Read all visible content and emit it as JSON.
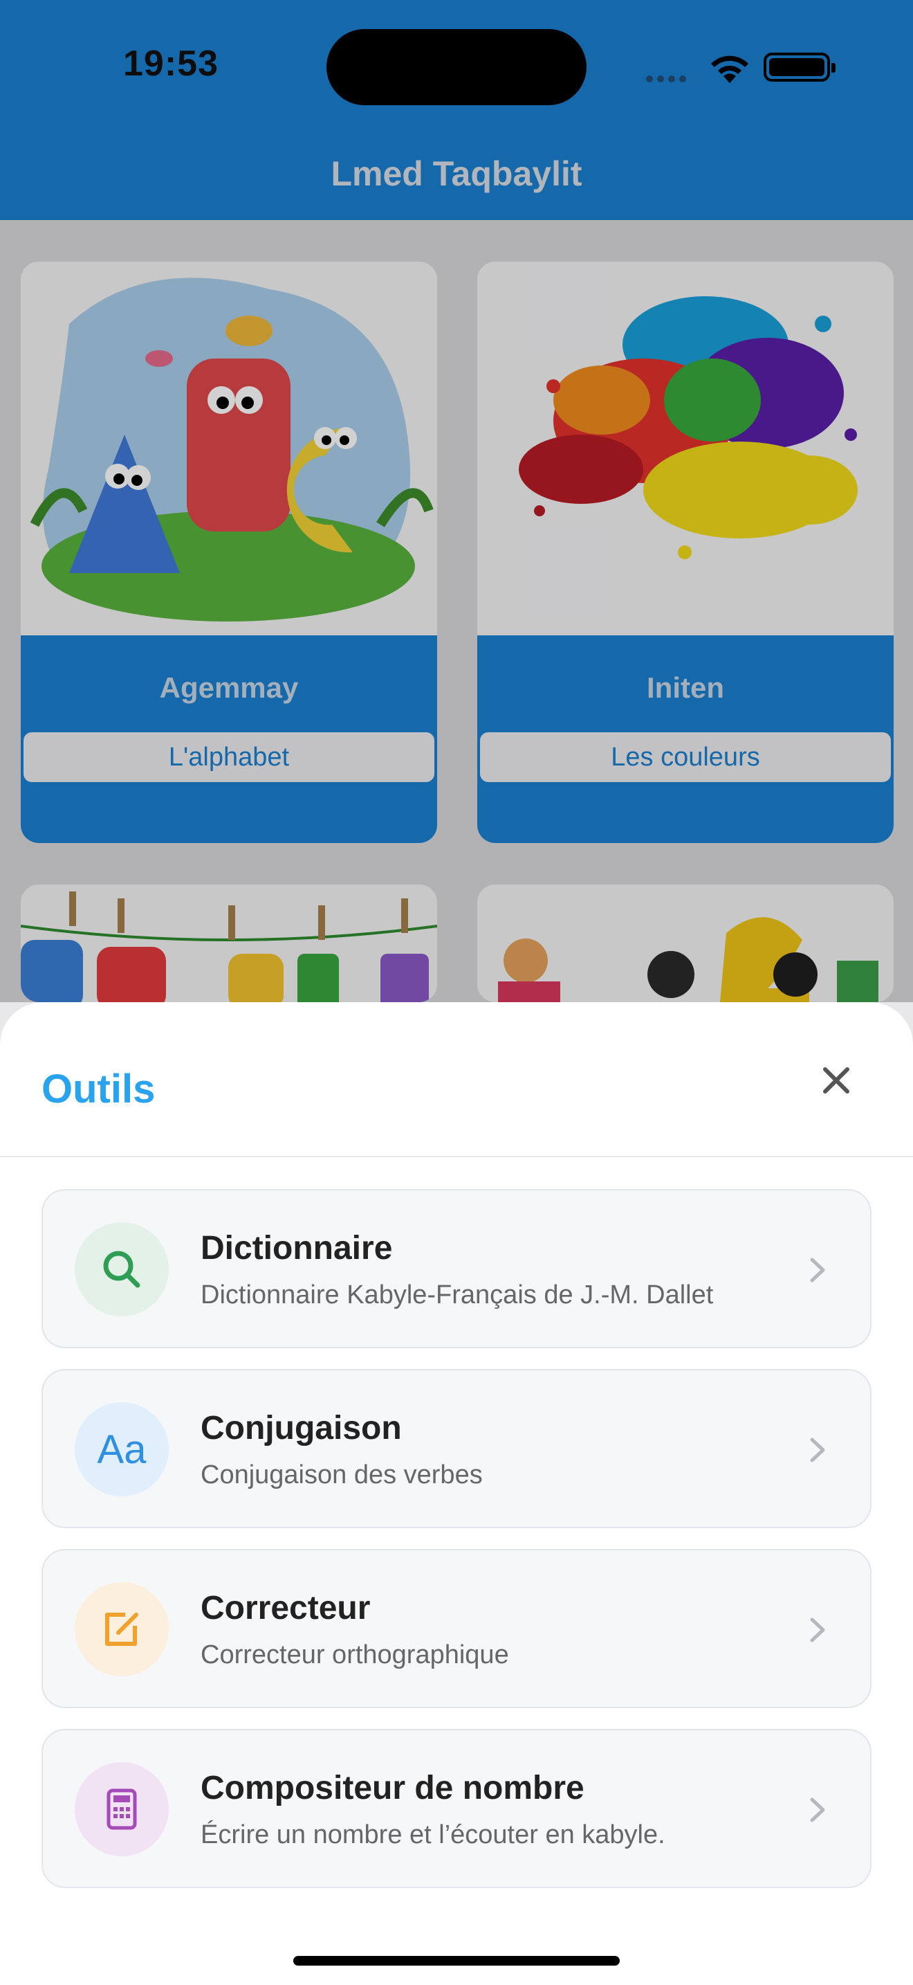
{
  "status_bar": {
    "time": "19:53"
  },
  "header": {
    "title": "Lmed Taqbaylit"
  },
  "cards": [
    {
      "kabyle": "Agemmay",
      "french": "L'alphabet"
    },
    {
      "kabyle": "Initen",
      "french": "Les couleurs"
    }
  ],
  "sheet": {
    "title": "Outils",
    "items": [
      {
        "name": "Dictionnaire",
        "desc": "Dictionnaire Kabyle-Français de J.-M. Dallet",
        "icon": "search-icon",
        "color": "#2e9e54",
        "bg": "#e3f1e8"
      },
      {
        "name": "Conjugaison",
        "desc": "Conjugaison des verbes",
        "icon": "text-aa-icon",
        "icon_text": "Aa",
        "color": "#2f8fe0",
        "bg": "#e1eefb"
      },
      {
        "name": "Correcteur",
        "desc": "Correcteur orthographique",
        "icon": "edit-icon",
        "color": "#f0a12d",
        "bg": "#fcefdd"
      },
      {
        "name": "Compositeur de nombre",
        "desc": "Écrire un nombre et l’écouter en kabyle.",
        "icon": "calculator-icon",
        "color": "#a54bb8",
        "bg": "#f1e3f3"
      }
    ]
  }
}
